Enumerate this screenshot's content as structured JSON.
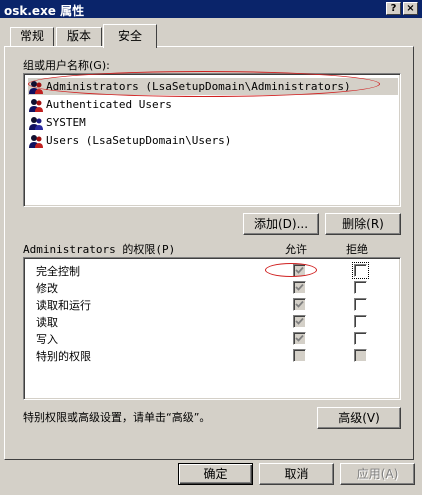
{
  "window": {
    "title": "osk.exe 属性",
    "help_label": "?",
    "close_label": "×"
  },
  "tabs": [
    {
      "label": "常规"
    },
    {
      "label": "版本"
    },
    {
      "label": "安全"
    }
  ],
  "users_group": {
    "label": "组或用户名称(G):",
    "items": [
      {
        "name": "Administrators (LsaSetupDomain\\Administrators)",
        "selected": true
      },
      {
        "name": "Authenticated Users"
      },
      {
        "name": "SYSTEM"
      },
      {
        "name": "Users (LsaSetupDomain\\Users)"
      }
    ],
    "add_label": "添加(D)...",
    "remove_label": "删除(R)"
  },
  "permissions": {
    "label": "Administrators 的权限(P)",
    "allow_header": "允许",
    "deny_header": "拒绝",
    "rows": [
      {
        "label": "完全控制",
        "allow": "checked-grey",
        "deny": "unchecked"
      },
      {
        "label": "修改",
        "allow": "checked-grey",
        "deny": "unchecked"
      },
      {
        "label": "读取和运行",
        "allow": "checked-grey",
        "deny": "unchecked"
      },
      {
        "label": "读取",
        "allow": "checked-grey",
        "deny": "unchecked"
      },
      {
        "label": "写入",
        "allow": "checked-grey",
        "deny": "unchecked"
      },
      {
        "label": "特别的权限",
        "allow": "grey",
        "deny": "grey"
      }
    ]
  },
  "advanced": {
    "text": "特别权限或高级设置，请单击“高级”。",
    "button_label": "高级(V)"
  },
  "footer": {
    "ok_label": "确定",
    "cancel_label": "取消",
    "apply_label": "应用(A)"
  },
  "colors": {
    "titlebar": "#0a246a",
    "face": "#d4d0c8",
    "annotation": "#d02020"
  }
}
